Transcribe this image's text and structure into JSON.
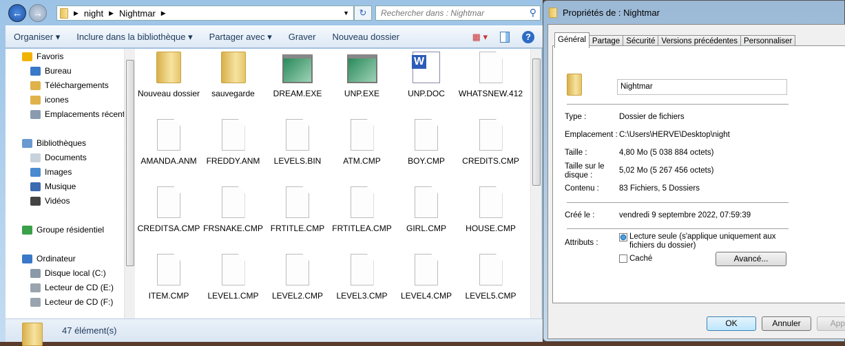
{
  "explorer": {
    "breadcrumb": [
      "night",
      "Nightmar"
    ],
    "search_placeholder": "Rechercher dans : Nightmar",
    "toolbar": {
      "organiser": "Organiser",
      "include": "Inclure dans la bibliothèque",
      "share": "Partager avec",
      "burn": "Graver",
      "new_folder": "Nouveau dossier"
    },
    "sidebar": [
      {
        "label": "Favoris",
        "icon": "star-icon",
        "color": "#f0b400"
      },
      {
        "label": "Bureau",
        "icon": "desktop-icon",
        "color": "#3a78c8"
      },
      {
        "label": "Téléchargements",
        "icon": "downloads-folder-icon",
        "color": "#e0b24a"
      },
      {
        "label": "icones",
        "icon": "folder-icon",
        "color": "#e0b24a"
      },
      {
        "label": "Emplacements récents",
        "icon": "recent-places-icon",
        "color": "#8a9bb0"
      },
      {
        "label": "Bibliothèques",
        "icon": "libraries-icon",
        "color": "#6a9ad0"
      },
      {
        "label": "Documents",
        "icon": "documents-icon",
        "color": "#c8d2dc"
      },
      {
        "label": "Images",
        "icon": "pictures-icon",
        "color": "#4a8ad0"
      },
      {
        "label": "Musique",
        "icon": "music-icon",
        "color": "#3a6ab0"
      },
      {
        "label": "Vidéos",
        "icon": "videos-icon",
        "color": "#444444"
      },
      {
        "label": "Groupe résidentiel",
        "icon": "homegroup-icon",
        "color": "#3aa04a"
      },
      {
        "label": "Ordinateur",
        "icon": "computer-icon",
        "color": "#3a78c8"
      },
      {
        "label": "Disque local (C:)",
        "icon": "local-disk-icon",
        "color": "#8a9aa8"
      },
      {
        "label": "Lecteur de CD (E:)",
        "icon": "cd-drive-icon",
        "color": "#9aa4ae"
      },
      {
        "label": "Lecteur de CD (F:)",
        "icon": "cd-drive-icon",
        "color": "#9aa4ae"
      }
    ],
    "files": [
      {
        "name": "Nouveau dossier",
        "type": "folder"
      },
      {
        "name": "sauvegarde",
        "type": "folder"
      },
      {
        "name": "DREAM.EXE",
        "type": "exe"
      },
      {
        "name": "UNP.EXE",
        "type": "exe"
      },
      {
        "name": "UNP.DOC",
        "type": "word"
      },
      {
        "name": "WHATSNEW.412",
        "type": "doc"
      },
      {
        "name": "AMANDA.ANM",
        "type": "doc"
      },
      {
        "name": "FREDDY.ANM",
        "type": "doc"
      },
      {
        "name": "LEVELS.BIN",
        "type": "doc"
      },
      {
        "name": "ATM.CMP",
        "type": "doc"
      },
      {
        "name": "BOY.CMP",
        "type": "doc"
      },
      {
        "name": "CREDITS.CMP",
        "type": "doc"
      },
      {
        "name": "CREDITSA.CMP",
        "type": "doc"
      },
      {
        "name": "FRSNAKE.CMP",
        "type": "doc"
      },
      {
        "name": "FRTITLE.CMP",
        "type": "doc"
      },
      {
        "name": "FRTITLEA.CMP",
        "type": "doc"
      },
      {
        "name": "GIRL.CMP",
        "type": "doc"
      },
      {
        "name": "HOUSE.CMP",
        "type": "doc"
      },
      {
        "name": "ITEM.CMP",
        "type": "doc"
      },
      {
        "name": "LEVEL1.CMP",
        "type": "doc"
      },
      {
        "name": "LEVEL2.CMP",
        "type": "doc"
      },
      {
        "name": "LEVEL3.CMP",
        "type": "doc"
      },
      {
        "name": "LEVEL4.CMP",
        "type": "doc"
      },
      {
        "name": "LEVEL5.CMP",
        "type": "doc"
      }
    ],
    "status": "47 élément(s)"
  },
  "dialog": {
    "title": "Propriétés de : Nightmar",
    "tabs": [
      "Général",
      "Partage",
      "Sécurité",
      "Versions précédentes",
      "Personnaliser"
    ],
    "name": "Nightmar",
    "type_label": "Type :",
    "type": "Dossier de fichiers",
    "location_label": "Emplacement :",
    "location": "C:\\Users\\HERVE\\Desktop\\night",
    "size_label": "Taille :",
    "size": "4,80 Mo (5 038 884 octets)",
    "disk_size_label": "Taille sur le disque :",
    "disk_size": "5,02 Mo (5 267 456 octets)",
    "contents_label": "Contenu :",
    "contents": "83 Fichiers, 5 Dossiers",
    "created_label": "Créé le :",
    "created": "vendredi 9 septembre 2022, 07:59:39",
    "attributes_label": "Attributs :",
    "readonly": "Lecture seule (s'applique uniquement aux fichiers du dossier)",
    "hidden": "Caché",
    "advanced": "Avancé...",
    "ok": "OK",
    "cancel": "Annuler",
    "apply": "Applic"
  }
}
